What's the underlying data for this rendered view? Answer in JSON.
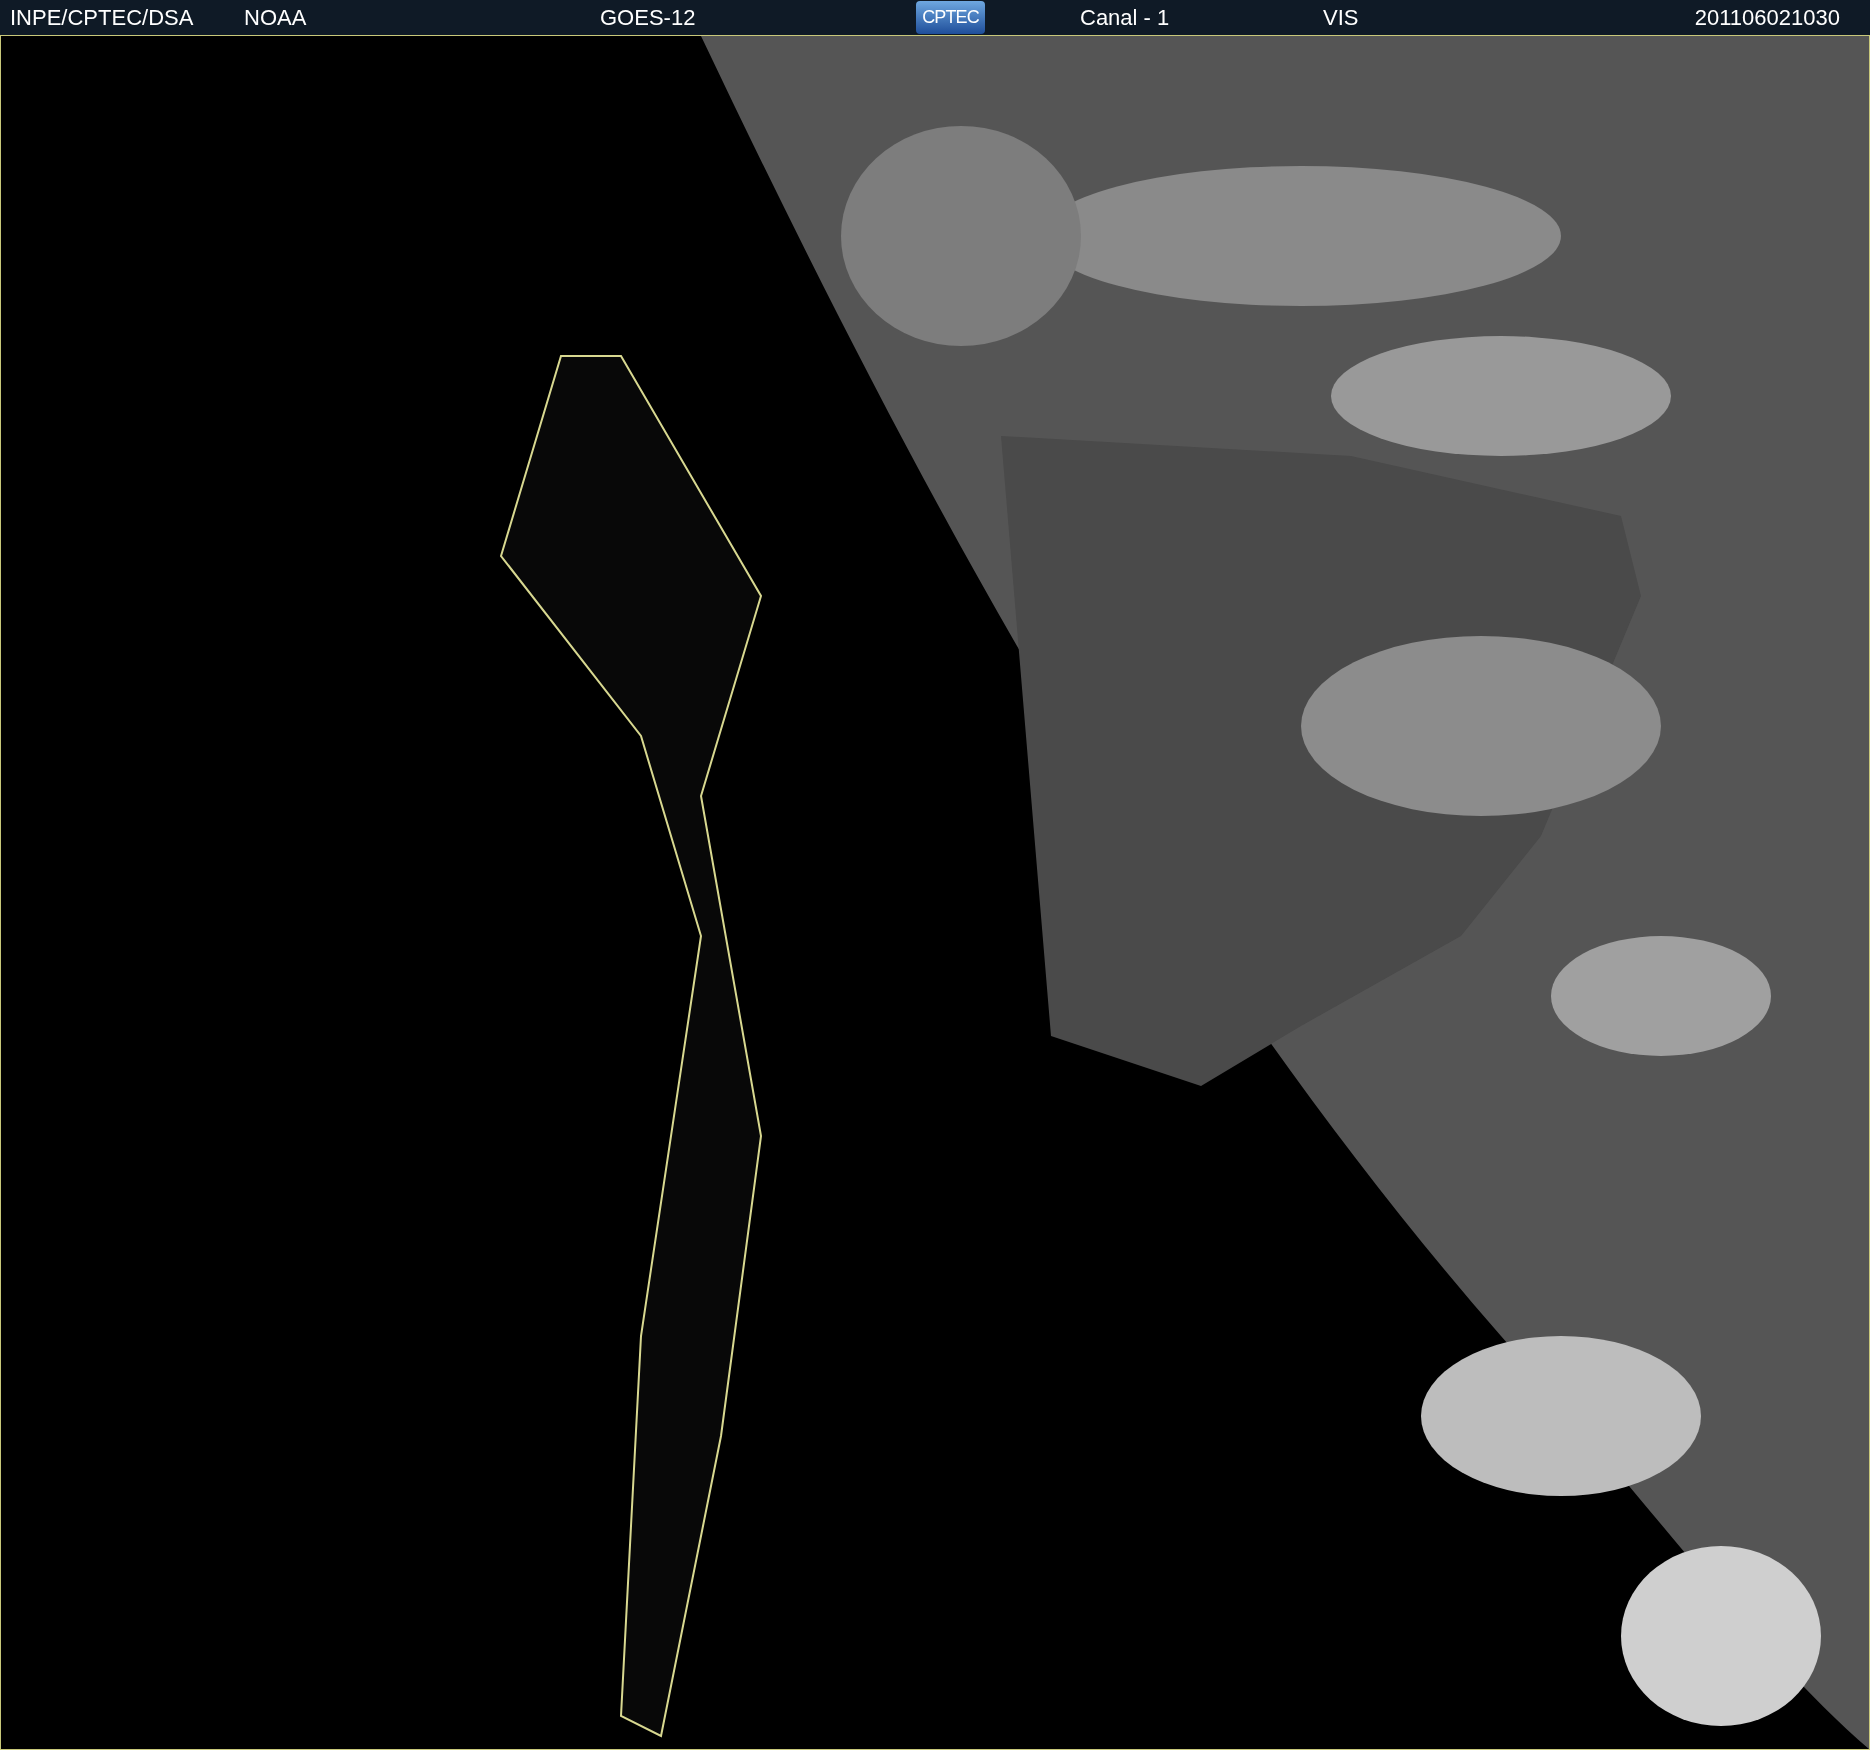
{
  "header": {
    "source": "INPE/CPTEC/DSA",
    "agency": "NOAA",
    "satellite": "GOES-12",
    "logo": "CPTEC",
    "channel": "Canal - 1",
    "band": "VIS",
    "timestamp": "201106021030"
  }
}
